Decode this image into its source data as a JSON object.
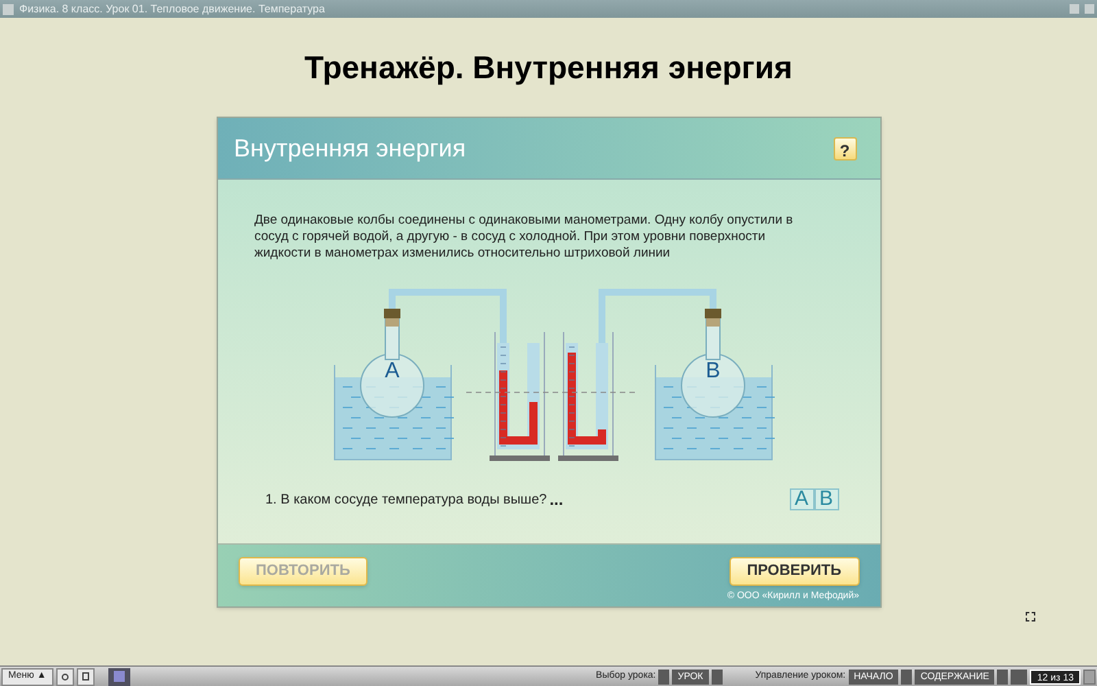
{
  "window": {
    "title": "Физика. 8 класс. Урок 01. Тепловое движение. Температура"
  },
  "heading": "Тренажёр. Внутренняя энергия",
  "card": {
    "title": "Внутренняя энергия",
    "help": "?",
    "description": "Две одинаковые колбы соединены с одинаковыми манометрами. Одну колбу опустили в сосуд с горячей водой, а другую - в сосуд с холодной. При этом уровни поверхности жидкости в манометрах изменились относительно штриховой линии",
    "flask_labels": [
      "A",
      "B"
    ],
    "question": "1. В каком сосуде температура воды выше?",
    "blank": "...",
    "answers": [
      {
        "label": "A",
        "selected": false
      },
      {
        "label": "B",
        "selected": false
      }
    ],
    "buttons": [
      {
        "label": "ПОВТОРИТЬ",
        "disabled": true
      },
      {
        "label": "ПРОВЕРИТЬ",
        "disabled": false
      }
    ],
    "copyright": "© ООО «Кирилл и Мефодий»"
  },
  "taskbar": {
    "menu": "Меню",
    "menu_arrow": "▲",
    "lesson_label": "Выбор урока:",
    "lesson": "УРОК",
    "control_label": "Управление уроком:",
    "start": "НАЧАЛО",
    "contents": "СОДЕРЖАНИЕ",
    "page": "12 из 13"
  }
}
